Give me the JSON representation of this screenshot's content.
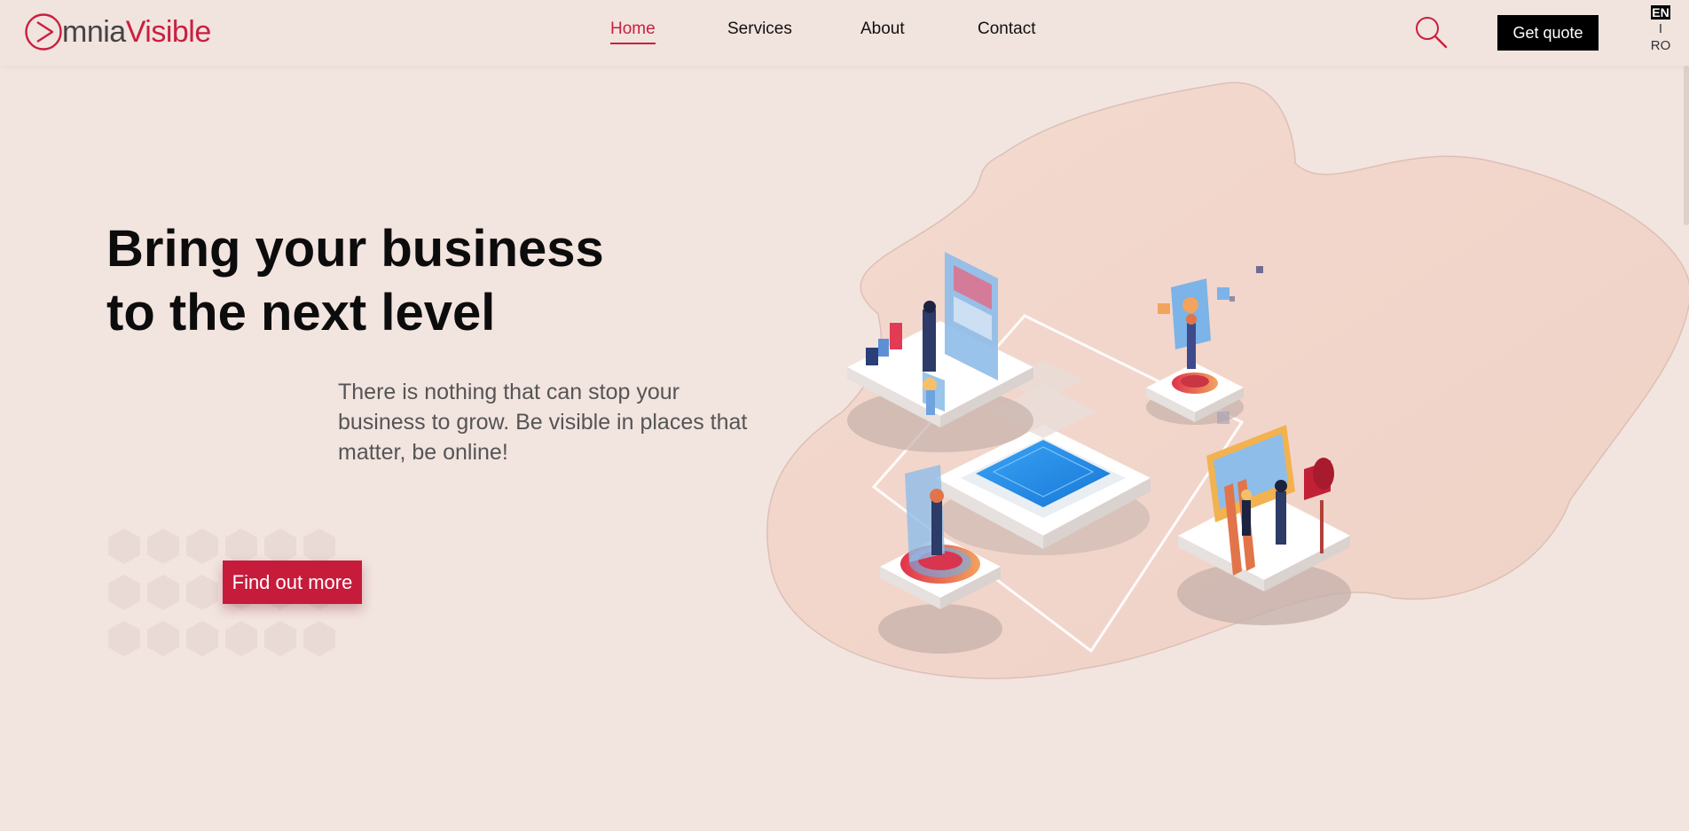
{
  "brand": {
    "name_part1": "mnia",
    "name_part2": "Visible",
    "accent_color": "#c8203f"
  },
  "nav": {
    "items": [
      {
        "label": "Home",
        "active": true
      },
      {
        "label": "Services",
        "active": false
      },
      {
        "label": "About",
        "active": false
      },
      {
        "label": "Contact",
        "active": false
      }
    ]
  },
  "header": {
    "search_icon": "search-icon",
    "quote_label": "Get quote"
  },
  "language": {
    "current": "EN",
    "separator": "I",
    "other": "RO"
  },
  "hero": {
    "title_line1": "Bring your business",
    "title_line2": "to the next level",
    "subtitle": "There is nothing that can stop your business to grow. Be visible in places that matter, be online!",
    "cta_label": "Find out more",
    "cta_color": "#c61b3b"
  }
}
